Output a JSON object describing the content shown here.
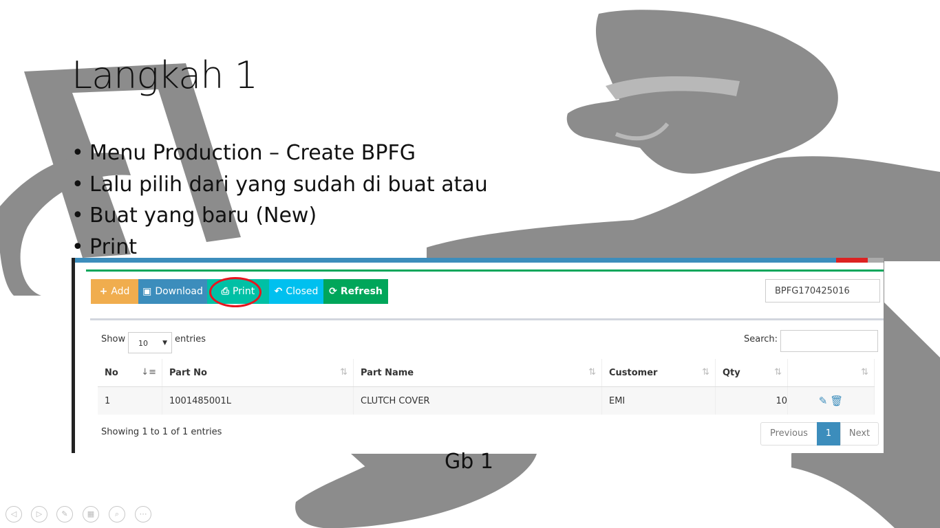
{
  "slide": {
    "title": "Langkah 1",
    "bullets": [
      "Menu Production – Create BPFG",
      "Lalu pilih dari yang sudah di buat atau",
      "Buat yang baru (New)",
      "Print"
    ],
    "caption": "Gb 1"
  },
  "app": {
    "toolbar": {
      "add_label": "Add",
      "download_label": "Download",
      "print_label": "Print",
      "closed_label": "Closed",
      "refresh_label": "Refresh"
    },
    "doc_number": "BPFG170425016",
    "table_controls": {
      "show_label": "Show",
      "page_length": "10",
      "entries_label": "entries",
      "search_label": "Search:"
    },
    "columns": [
      "No",
      "Part No",
      "Part Name",
      "Customer",
      "Qty"
    ],
    "rows": [
      {
        "no": "1",
        "part_no": "1001485001L",
        "part_name": "CLUTCH COVER",
        "customer": "EMI",
        "qty": "10"
      }
    ],
    "info": "Showing 1 to 1 of 1 entries",
    "pagination": {
      "previous": "Previous",
      "current": "1",
      "next": "Next"
    }
  },
  "colors": {
    "add": "#f0ad4e",
    "download": "#3c8dbc",
    "print": "#00c0a5",
    "closed": "#00c0ef",
    "refresh": "#00a65a",
    "highlight": "#e8141e",
    "figure_gray": "#8c8c8c"
  }
}
